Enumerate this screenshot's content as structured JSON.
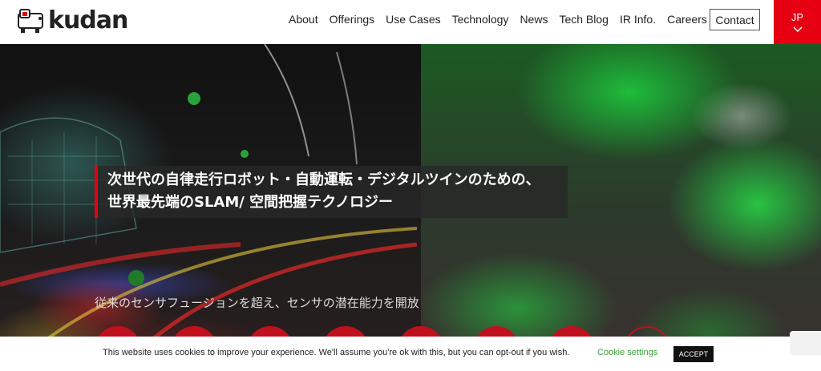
{
  "brand": {
    "name": "kudan",
    "accent": "#e60012"
  },
  "nav": {
    "items": [
      "About",
      "Offerings",
      "Use Cases",
      "Technology",
      "News",
      "Tech Blog",
      "IR Info.",
      "Careers"
    ],
    "contact": "Contact",
    "language": "JP"
  },
  "hero": {
    "headline_line1": "次世代の自律走行ロボット・自動運転・デジタルツインのための、",
    "headline_line2": "世界最先端のSLAM/ 空間把握テクノロジー",
    "subheadline": "従来のセンサフュージョンを超え、センサの潜在能力を開放"
  },
  "cookie": {
    "message": "This website uses cookies to improve your experience. We'll assume you're ok with this, but you can opt-out if you wish.",
    "settings_label": "Cookie settings",
    "accept_label": "ACCEPT"
  }
}
